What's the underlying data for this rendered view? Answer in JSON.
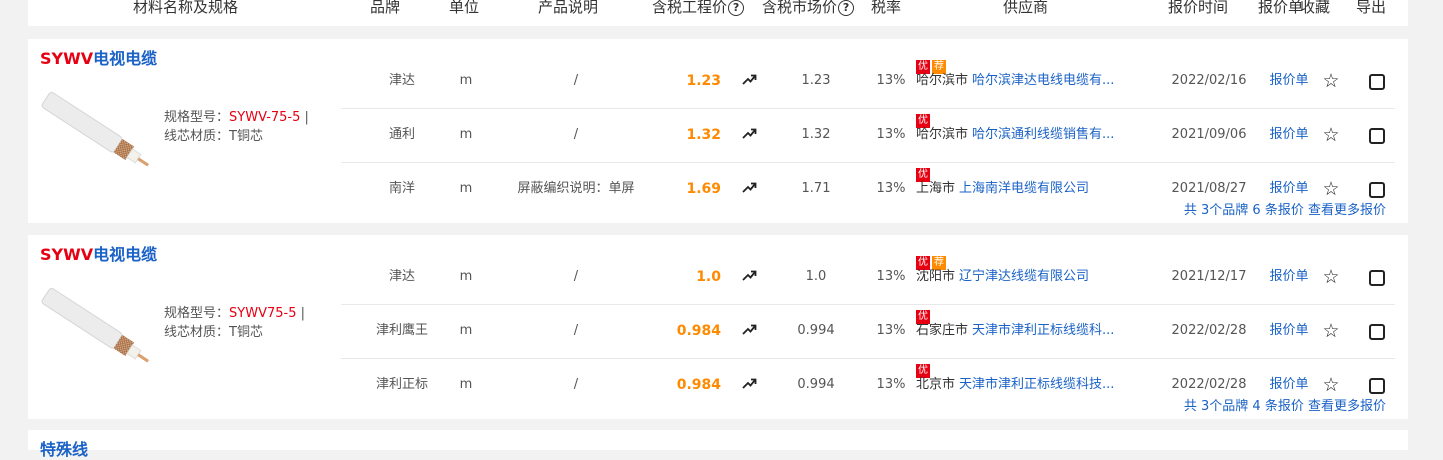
{
  "header": {
    "material": "材料名称及规格",
    "brand": "品牌",
    "unit": "单位",
    "desc": "产品说明",
    "taxed_price": "含税工程价",
    "market_price": "含税市场价",
    "tax_rate": "税率",
    "supplier": "供应商",
    "quote_time": "报价时间",
    "quote_sheet": "报价单",
    "favorite": "收藏",
    "export": "导出",
    "help_glyph": "?"
  },
  "products": [
    {
      "code": "SYWV",
      "name": "电视电缆",
      "spec_label": "规格型号：",
      "spec_value": "SYWV-75-5",
      "spec_sep": " |",
      "core_label": "线芯材质：",
      "core_value": "T铜芯",
      "rows": [
        {
          "brand": "津达",
          "unit": "m",
          "desc": "/",
          "price": "1.23",
          "market": "1.23",
          "tax": "13%",
          "badges": [
            "优",
            "荐"
          ],
          "city": "哈尔滨市",
          "supplier": "哈尔滨津达电线电缆有...",
          "date": "2022/02/16",
          "link": "报价单"
        },
        {
          "brand": "通利",
          "unit": "m",
          "desc": "/",
          "price": "1.32",
          "market": "1.32",
          "tax": "13%",
          "badges": [
            "优"
          ],
          "city": "哈尔滨市",
          "supplier": "哈尔滨通利线缆销售有...",
          "date": "2021/09/06",
          "link": "报价单"
        },
        {
          "brand": "南洋",
          "unit": "m",
          "desc": "屏蔽编织说明：单屏",
          "price": "1.69",
          "market": "1.71",
          "tax": "13%",
          "badges": [
            "优"
          ],
          "city": "上海市",
          "supplier": "上海南洋电缆有限公司",
          "date": "2021/08/27",
          "link": "报价单"
        }
      ],
      "footer_a": "共 3个品牌 6 条报价",
      "footer_b": "查看更多报价"
    },
    {
      "code": "SYWV",
      "name": "电视电缆",
      "spec_label": "规格型号：",
      "spec_value": "SYWV75-5",
      "spec_sep": " |",
      "core_label": "线芯材质：",
      "core_value": "T铜芯",
      "rows": [
        {
          "brand": "津达",
          "unit": "m",
          "desc": "/",
          "price": "1.0",
          "market": "1.0",
          "tax": "13%",
          "badges": [
            "优",
            "荐"
          ],
          "city": "沈阳市",
          "supplier": "辽宁津达线缆有限公司",
          "date": "2021/12/17",
          "link": "报价单"
        },
        {
          "brand": "津利鹰王",
          "unit": "m",
          "desc": "/",
          "price": "0.984",
          "market": "0.994",
          "tax": "13%",
          "badges": [
            "优"
          ],
          "city": "石家庄市",
          "supplier": "天津市津利正标线缆科...",
          "date": "2022/02/28",
          "link": "报价单"
        },
        {
          "brand": "津利正标",
          "unit": "m",
          "desc": "/",
          "price": "0.984",
          "market": "0.994",
          "tax": "13%",
          "badges": [
            "优"
          ],
          "city": "北京市",
          "supplier": "天津市津利正标线缆科技...",
          "date": "2022/02/28",
          "link": "报价单"
        }
      ],
      "footer_a": "共 3个品牌 4 条报价",
      "footer_b": "查看更多报价"
    }
  ],
  "next_product_title": "特殊线"
}
